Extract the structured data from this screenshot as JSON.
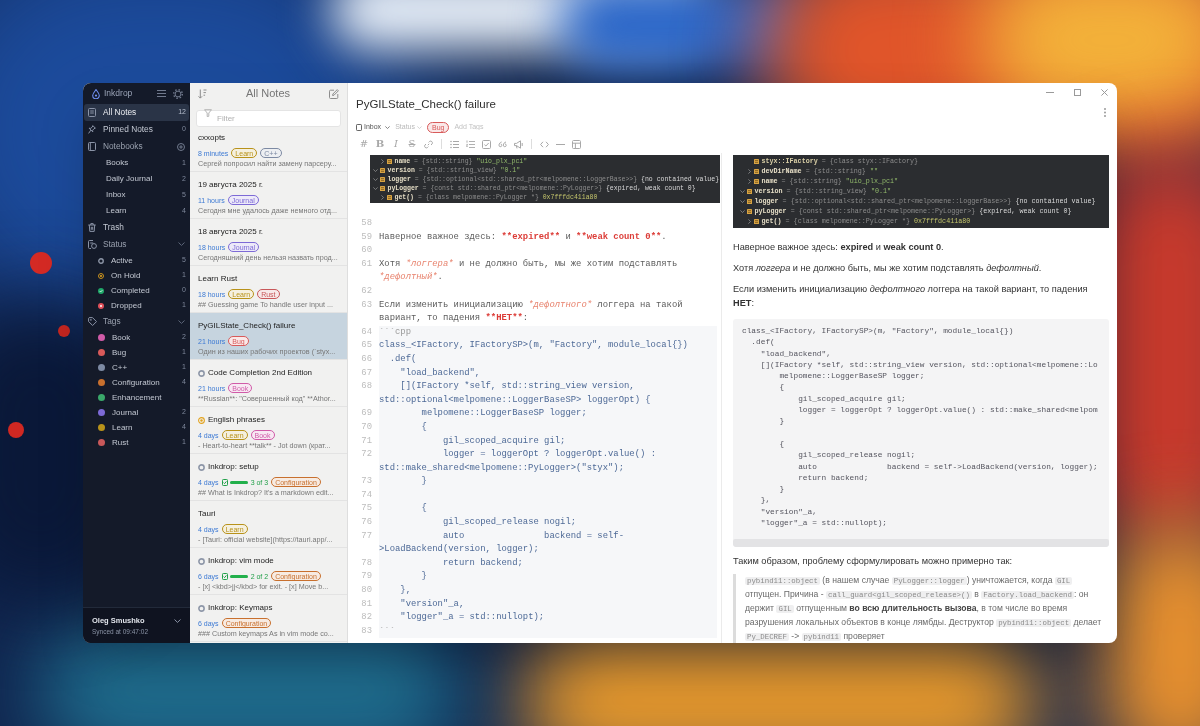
{
  "sidebar": {
    "app_name": "Inkdrop",
    "items": [
      {
        "label": "All Notes",
        "count": "12",
        "selected": true
      },
      {
        "label": "Pinned Notes",
        "count": "0",
        "selected": false
      }
    ],
    "notebooks": {
      "label": "Notebooks",
      "items": [
        {
          "label": "Books",
          "count": "1",
          "selected": false
        },
        {
          "label": "Daily Journal",
          "count": "2",
          "selected": false
        },
        {
          "label": "Inbox",
          "count": "5",
          "selected": false
        },
        {
          "label": "Learn",
          "count": "4",
          "selected": false
        }
      ]
    },
    "trash": {
      "label": "Trash",
      "selected": false
    },
    "status": {
      "label": "Status",
      "expanded": true,
      "items": [
        {
          "label": "Active",
          "count": "5",
          "kind": "active",
          "selected": false
        },
        {
          "label": "On Hold",
          "count": "1",
          "kind": "on_hold",
          "selected": false
        },
        {
          "label": "Completed",
          "count": "0",
          "kind": "completed",
          "selected": false
        },
        {
          "label": "Dropped",
          "count": "1",
          "kind": "dropped",
          "selected": false
        }
      ]
    },
    "tags": {
      "label": "Tags",
      "expanded": true,
      "items": [
        {
          "label": "Book",
          "count": "2",
          "color": "#d05ba8",
          "selected": false
        },
        {
          "label": "Bug",
          "count": "1",
          "color": "#d85a5a",
          "selected": false
        },
        {
          "label": "C++",
          "count": "1",
          "color": "#7d8aa3",
          "selected": false
        },
        {
          "label": "Configuration",
          "count": "4",
          "color": "#c8702e",
          "selected": false
        },
        {
          "label": "Enhancement",
          "color": "#3aa86a",
          "selected": false
        },
        {
          "label": "Journal",
          "count": "2",
          "color": "#7d6ad6",
          "selected": false
        },
        {
          "label": "Learn",
          "count": "4",
          "color": "#b8921a",
          "selected": false
        },
        {
          "label": "Rust",
          "count": "1",
          "color": "#c8585a",
          "selected": false
        }
      ]
    },
    "account": {
      "name": "Oleg Smushko",
      "sync_status": "Synced at 09:47:02"
    }
  },
  "note_list": {
    "title": "All Notes",
    "filter": {
      "placeholder": "Filter"
    },
    "notes": [
      {
        "title": "cxxopts",
        "kind": "plain",
        "time": "8 minutes",
        "tags": [
          {
            "label": "Learn",
            "color": "#b8921a"
          },
          {
            "label": "C++",
            "color": "#7d8aa3"
          }
        ],
        "preview": "Сергей попросил найти замену парсеру...",
        "selected": false
      },
      {
        "title": "19 августа 2025 г.",
        "kind": "plain",
        "time": "11 hours",
        "tags": [
          {
            "label": "Journal",
            "color": "#7d6ad6"
          }
        ],
        "preview": "Сегодня мне удалось даже немного отд...",
        "selected": false
      },
      {
        "title": "18 августа 2025 г.",
        "kind": "plain",
        "time": "18 hours",
        "tags": [
          {
            "label": "Journal",
            "color": "#7d6ad6"
          }
        ],
        "preview": "Сегодняшний день нельзя назвать прод...",
        "selected": false
      },
      {
        "title": "Learn Rust",
        "kind": "plain",
        "time": "18 hours",
        "tags": [
          {
            "label": "Learn",
            "color": "#b8921a"
          },
          {
            "label": "Rust",
            "color": "#c8585a"
          }
        ],
        "preview": "## Guessing game To handle user input ...",
        "selected": false
      },
      {
        "title": "PyGILState_Check() failure",
        "kind": "plain",
        "time": "21 hours",
        "tags": [
          {
            "label": "Bug",
            "color": "#d85a5a"
          }
        ],
        "preview": "Один из наших рабочих проектов (`styx...",
        "selected": true
      },
      {
        "title": "Code Completion 2nd Edition",
        "kind": "active",
        "time": "21 hours",
        "tags": [
          {
            "label": "Book",
            "color": "#d05ba8"
          }
        ],
        "preview": "**Russian**: \"Совершенный код\" **Athor...",
        "selected": false
      },
      {
        "title": "English phrases",
        "kind": "on_hold",
        "time": "4 days",
        "tags": [
          {
            "label": "Learn",
            "color": "#b8921a"
          },
          {
            "label": "Book",
            "color": "#d05ba8"
          }
        ],
        "preview": "- Heart-to-heart **talk** - Jot down (крат...",
        "selected": false
      },
      {
        "title": "Inkdrop: setup",
        "kind": "active",
        "time": "4 days",
        "tasks": {
          "label": "3 of 3",
          "level": 1
        },
        "tags": [
          {
            "label": "Configuration",
            "color": "#c8702e"
          }
        ],
        "preview": "## What is Inkdrop? It's a markdown edit...",
        "selected": false
      },
      {
        "title": "Tauri",
        "kind": "plain",
        "time": "4 days",
        "tags": [
          {
            "label": "Learn",
            "color": "#b8921a"
          }
        ],
        "preview": "- [Tauri: official website](https://tauri.app/...",
        "selected": false
      },
      {
        "title": "Inkdrop: vim mode",
        "kind": "active",
        "time": "6 days",
        "tasks": {
          "label": "2 of 2",
          "level": 1
        },
        "tags": [
          {
            "label": "Configuration",
            "color": "#c8702e"
          }
        ],
        "preview": "- [x] <kbd>jj</kbd> for exit. - [x] Move b...",
        "selected": false
      },
      {
        "title": "Inkdrop: Keymaps",
        "kind": "active",
        "time": "6 days",
        "tags": [
          {
            "label": "Configuration",
            "color": "#c8702e"
          }
        ],
        "preview": "### Custom keymaps As in vim mode co...",
        "selected": false
      }
    ]
  },
  "editor": {
    "title": "PyGILState_Check() failure",
    "notebook": "Inbox",
    "status_label": "Status",
    "tags": [
      {
        "label": "Bug",
        "color": "#d85a5a"
      }
    ],
    "tag_input": {
      "placeholder": "Add Tags"
    },
    "toolbar": [
      {
        "label": "#",
        "kind": "heading"
      },
      {
        "label": "B",
        "kind": "bold"
      },
      {
        "label": "I",
        "kind": "italic"
      },
      {
        "label": "S",
        "kind": "strike"
      }
    ],
    "source": {
      "image": {
        "continued_rows": [
          {
            "name": "name",
            "type": "= {std::string}",
            "value": "\"uio_plx_pci\"",
            "kind": "string",
            "expanded": false
          }
        ],
        "rows": [
          {
            "name": "version",
            "type": "= {std::string_view}",
            "value": "\"0.1\"",
            "kind": "string",
            "expanded": true
          },
          {
            "name": "logger",
            "type": "= {std::optional<std::shared_ptr<melpomene::LoggerBase>>}",
            "value": "{no contained value}",
            "kind": "plain",
            "expanded": true
          },
          {
            "name": "pyLogger",
            "type": "= {const std::shared_ptr<melpomene::PyLogger>}",
            "value": "{expired, weak count 0}",
            "kind": "plain",
            "expanded": true,
            "children": [
              {
                "name": "get()",
                "type": "= {class melpomene::PyLogger *}",
                "value": "0x7fffdc411a80",
                "kind": "address",
                "expanded": false
              }
            ]
          }
        ]
      },
      "lines": [
        {
          "number": "58",
          "kind": "prose"
        },
        {
          "number": "59",
          "kind": "prose",
          "segments": [
            {
              "text": "Наверное важное здесь: ",
              "kind": "plain"
            },
            {
              "text": "**expired**",
              "kind": "strong"
            },
            {
              "text": " и ",
              "kind": "plain"
            },
            {
              "text": "**weak count 0**",
              "kind": "strong"
            },
            {
              "text": ".",
              "kind": "plain"
            }
          ]
        },
        {
          "number": "60",
          "kind": "prose"
        },
        {
          "number": "61",
          "kind": "prose",
          "segments": [
            {
              "text": "Хотя ",
              "kind": "plain"
            },
            {
              "text": "*логгера*",
              "kind": "emphasis"
            },
            {
              "text": " и не должно быть, мы же хотим подставлять ",
              "kind": "plain"
            },
            {
              "text": "*дефолтный*",
              "kind": "emphasis"
            },
            {
              "text": ".",
              "kind": "plain"
            }
          ]
        },
        {
          "number": "62",
          "kind": "prose"
        },
        {
          "number": "63",
          "kind": "prose",
          "segments": [
            {
              "text": "Если изменить инициализацию ",
              "kind": "plain"
            },
            {
              "text": "*дефолтного*",
              "kind": "emphasis"
            },
            {
              "text": " логгера на такой вариант, то падения ",
              "kind": "plain"
            },
            {
              "text": "**НЕТ**",
              "kind": "strong"
            },
            {
              "text": ":",
              "kind": "plain"
            }
          ]
        },
        {
          "number": "64",
          "kind": "fence",
          "text": "```cpp"
        },
        {
          "number": "65",
          "kind": "code",
          "text": "class_<IFactory, IFactorySP>(m, \"Factory\", module_local{})"
        },
        {
          "number": "66",
          "kind": "code",
          "text": "  .def("
        },
        {
          "number": "67",
          "kind": "code",
          "text": "    \"load_backend\","
        },
        {
          "number": "68",
          "kind": "code",
          "text": "    [](IFactory *self, std::string_view version, std::optional<melpomene::LoggerBaseSP> loggerOpt) {"
        },
        {
          "number": "69",
          "kind": "code",
          "text": "        melpomene::LoggerBaseSP logger;"
        },
        {
          "number": "70",
          "kind": "code",
          "text": "        {"
        },
        {
          "number": "71",
          "kind": "code",
          "text": "            gil_scoped_acquire gil;"
        },
        {
          "number": "72",
          "kind": "code",
          "text": "            logger = loggerOpt ? loggerOpt.value() : std::make_shared<melpomene::PyLogger>(\"styx\");"
        },
        {
          "number": "73",
          "kind": "code",
          "text": "        }"
        },
        {
          "number": "74",
          "kind": "code"
        },
        {
          "number": "75",
          "kind": "code",
          "text": "        {"
        },
        {
          "number": "76",
          "kind": "code",
          "text": "            gil_scoped_release nogil;"
        },
        {
          "number": "77",
          "kind": "code",
          "text": "            auto               backend = self->LoadBackend(version, logger);"
        },
        {
          "number": "78",
          "kind": "code",
          "text": "            return backend;"
        },
        {
          "number": "79",
          "kind": "code",
          "text": "        }"
        },
        {
          "number": "80",
          "kind": "code",
          "text": "    },"
        },
        {
          "number": "81",
          "kind": "code",
          "text": "    \"version\"_a,"
        },
        {
          "number": "82",
          "kind": "code",
          "text": "    \"logger\"_a = std::nullopt);"
        },
        {
          "number": "83",
          "kind": "fence",
          "text": "```"
        }
      ]
    },
    "preview": {
      "image": {
        "continued_rows": [
          {
            "name": "styx::IFactory",
            "type": "= {class styx::IFactory}",
            "kind": "class"
          },
          {
            "name": "devDirName",
            "type": "= {std::string}",
            "value": "\"\"",
            "kind": "string",
            "expanded": false
          },
          {
            "name": "name",
            "type": "= {std::string}",
            "value": "\"uio_plx_pci\"",
            "kind": "string",
            "expanded": false
          }
        ],
        "rows": [
          {
            "name": "version",
            "type": "= {std::string_view}",
            "value": "\"0.1\"",
            "kind": "string",
            "expanded": true
          },
          {
            "name": "logger",
            "type": "= {std::optional<std::shared_ptr<melpomene::LoggerBase>>}",
            "value": "{no contained value}",
            "kind": "plain",
            "expanded": true
          },
          {
            "name": "pyLogger",
            "type": "= {const std::shared_ptr<melpomene::PyLogger>}",
            "value": "{expired, weak count 0}",
            "kind": "plain",
            "expanded": true,
            "children": [
              {
                "name": "get()",
                "type": "= {class melpomene::PyLogger *}",
                "value": "0x7fffdc411a80",
                "kind": "address",
                "expanded": false
              }
            ]
          }
        ]
      },
      "blocks": [
        {
          "kind": "paragraph",
          "text": "Наверное важное здесь: **expired** и **weak count 0**."
        },
        {
          "kind": "paragraph",
          "text": "Хотя *логгера* и не должно быть, мы же хотим подставлять *дефолтный*."
        },
        {
          "kind": "paragraph",
          "text": "Если изменить инициализацию *дефолтного* логгера на такой вариант, то падения **НЕТ**:"
        },
        {
          "kind": "code",
          "text": "class_<IFactory, IFactorySP>(m, \"Factory\", module_local{})\n  .def(\n    \"load_backend\",\n    [](IFactory *self, std::string_view version, std::optional<melpomene::Lo\n        melpomene::LoggerBaseSP logger;\n        {\n            gil_scoped_acquire gil;\n            logger = loggerOpt ? loggerOpt.value() : std::make_shared<melpom\n        }\n\n        {\n            gil_scoped_release nogil;\n            auto               backend = self->LoadBackend(version, logger);\n            return backend;\n        }\n    },\n    \"version\"_a,\n    \"logger\"_a = std::nullopt);"
        },
        {
          "kind": "paragraph",
          "text": "Таким образом, проблему сформулировать можно примерно так:"
        },
        {
          "kind": "blockquote",
          "segments": [
            {
              "text": "pybind11::object",
              "kind": "code"
            },
            {
              "text": " (в нашем случае ",
              "kind": "plain"
            },
            {
              "text": "PyLogger::logger",
              "kind": "code"
            },
            {
              "text": ") уничтожается, когда ",
              "kind": "plain"
            },
            {
              "text": "GIL",
              "kind": "code"
            },
            {
              "text": " отпущен. Причина - ",
              "kind": "plain"
            },
            {
              "text": "call_guard<gil_scoped_release>()",
              "kind": "code"
            },
            {
              "text": " в ",
              "kind": "plain"
            },
            {
              "text": "Factory.load_backend",
              "kind": "code"
            },
            {
              "text": ": он держит ",
              "kind": "plain"
            },
            {
              "text": "GIL",
              "kind": "code"
            },
            {
              "text": " отпущенным ",
              "kind": "plain"
            },
            {
              "text": "во всю длительность вызова",
              "kind": "strong"
            },
            {
              "text": ", в том числе во время разрушения локальных объектов в конце лямбды. Деструктор ",
              "kind": "plain"
            },
            {
              "text": "pybind11::object",
              "kind": "code"
            },
            {
              "text": " делает ",
              "kind": "plain"
            },
            {
              "text": "Py_DECREF",
              "kind": "code"
            },
            {
              "text": " -> ",
              "kind": "plain"
            },
            {
              "text": "pybind11",
              "kind": "code"
            },
            {
              "text": " проверяет",
              "kind": "plain"
            }
          ]
        }
      ]
    }
  }
}
